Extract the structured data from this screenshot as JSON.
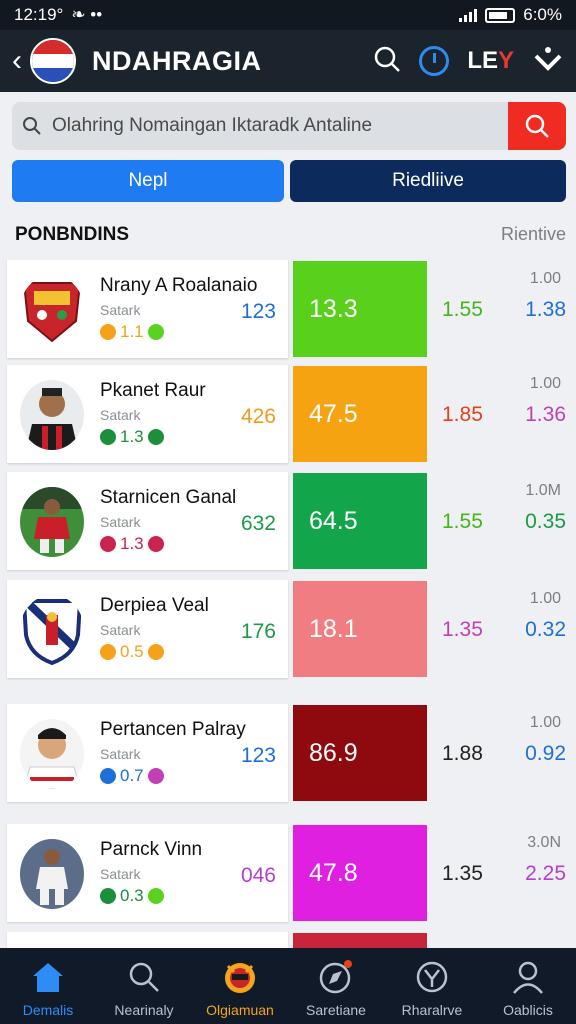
{
  "status": {
    "time": "12:19°",
    "battery": "6:0%"
  },
  "header": {
    "title": "NDAHRAGIA",
    "ley_main": "LE",
    "ley_accent": "Y"
  },
  "search": {
    "placeholder": "Olahring Nomaingan Iktaradk Antaline"
  },
  "tabs": [
    {
      "label": "Nepl"
    },
    {
      "label": "Riedliive"
    }
  ],
  "section": {
    "title": "PONBNDINS",
    "link": "Rientive"
  },
  "rows": [
    {
      "name": "Nrany A Roalanaio",
      "sub": "Satark",
      "badge": "1.1",
      "count": "123",
      "count_color": "#1e6fd9",
      "score": "13.3",
      "score_bg": "#59d11c",
      "odd1": "1.55",
      "odd1_color": "#46b51d",
      "top": "1.00",
      "odd2": "1.38",
      "odd2_color": "#1e6fd9",
      "dot1": "#f3a21b",
      "dot2": "#5bd21f"
    },
    {
      "name": "Pkanet Raur",
      "sub": "Satark",
      "badge": "1.3",
      "count": "426",
      "count_color": "#f09a1a",
      "score": "47.5",
      "score_bg": "#f6a312",
      "odd1": "1.85",
      "odd1_color": "#e2421e",
      "top": "1.00",
      "odd2": "1.36",
      "odd2_color": "#c43fb4",
      "dot1": "#1d8f3c",
      "dot2": "#1d8f3c"
    },
    {
      "name": "Starnicen Ganal",
      "sub": "Satark",
      "badge": "1.3",
      "count": "632",
      "count_color": "#1c9a4a",
      "score": "64.5",
      "score_bg": "#13a54a",
      "odd1": "1.55",
      "odd1_color": "#46b51d",
      "top": "1.0M",
      "odd2": "0.35",
      "odd2_color": "#1c9a4a",
      "dot1": "#c8244f",
      "dot2": "#c8244f"
    },
    {
      "name": "Derpiea Veal",
      "sub": "Satark",
      "badge": "0.5",
      "count": "176",
      "count_color": "#1c9a4a",
      "score": "18.1",
      "score_bg": "#f07d82",
      "odd1": "1.35",
      "odd1_color": "#c43fb4",
      "top": "1.00",
      "odd2": "0.32",
      "odd2_color": "#1e6fd9",
      "dot1": "#f3a21b",
      "dot2": "#f3a21b"
    },
    {
      "name": "Pertancen Palray",
      "sub": "Satark",
      "badge": "0.7",
      "count": "123",
      "count_color": "#1e6fd9",
      "score": "86.9",
      "score_bg": "#8f0a0f",
      "odd1": "1.88",
      "odd1_color": "#222222",
      "top": "1.00",
      "odd2": "0.92",
      "odd2_color": "#1e6fd9",
      "dot1": "#1e6fd9",
      "dot2": "#c43fb4"
    },
    {
      "name": "Parnck Vinn",
      "sub": "Satark",
      "badge": "0.3",
      "count": "046",
      "count_color": "#b53fd1",
      "score": "47.8",
      "score_bg": "#e020e0",
      "odd1": "1.35",
      "odd1_color": "#222222",
      "top": "3.0N",
      "odd2": "2.25",
      "odd2_color": "#b53fd1",
      "dot1": "#1d8f3c",
      "dot2": "#5bd21f"
    }
  ],
  "nav": [
    {
      "label": "Demalis",
      "icon": "home-icon"
    },
    {
      "label": "Nearinaly",
      "icon": "search-icon"
    },
    {
      "label": "Olgiamuan",
      "icon": "mascot-icon"
    },
    {
      "label": "Saretiane",
      "icon": "compass-icon"
    },
    {
      "label": "Rharalrve",
      "icon": "trophy-icon"
    },
    {
      "label": "Oablicis",
      "icon": "profile-icon"
    }
  ]
}
